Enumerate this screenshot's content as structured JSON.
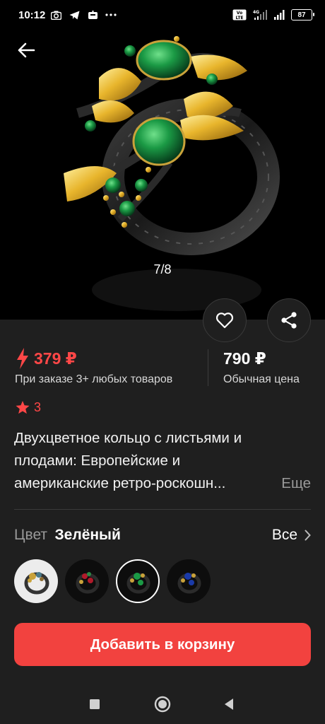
{
  "status_bar": {
    "time": "10:12",
    "left_icons": [
      "camera-icon",
      "telegram-icon",
      "app-icon",
      "more-icon"
    ],
    "right_icons": [
      "volte-icon",
      "4g-signal-icon",
      "signal-icon"
    ],
    "network_label_1": "Vo LTE",
    "network_label_2": "4G",
    "battery": "87"
  },
  "gallery": {
    "counter": "7/8",
    "image": "ring-photo"
  },
  "actions": {
    "favorite_icon": "heart-icon",
    "share_icon": "share-icon"
  },
  "pricing": {
    "promo_price": "379 ₽",
    "promo_condition": "При заказе 3+ любых товаров",
    "regular_price": "790 ₽",
    "regular_label": "Обычная цена"
  },
  "rating": {
    "value": "3"
  },
  "product": {
    "title_line1": "Двухцветное кольцо с листьями и",
    "title_line2": "плодами: Европейские и",
    "title_line3": "американские ретро-роскошн...",
    "more_label": "Еще"
  },
  "color": {
    "label": "Цвет",
    "selected": "Зелёный",
    "all_label": "Все",
    "swatches": [
      "ring-variant-1",
      "ring-variant-red",
      "ring-variant-green",
      "ring-variant-blue"
    ],
    "selected_index": 2
  },
  "cta": {
    "label": "Добавить в корзину"
  },
  "colors": {
    "accent": "#f2423f",
    "promo_red": "#ff4747",
    "background": "#1f1f1f"
  }
}
